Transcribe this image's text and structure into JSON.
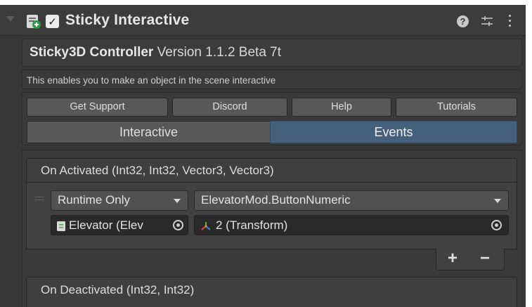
{
  "component": {
    "title": "Sticky Interactive",
    "enabled": true,
    "help_icon": "?",
    "icons": [
      "script-icon",
      "help-icon",
      "presets-icon",
      "kebab-menu-icon"
    ]
  },
  "controller": {
    "name": "Sticky3D Controller",
    "version": "Version 1.1.2 Beta 7t",
    "description": "This enables you to make an object in the scene interactive"
  },
  "buttons": {
    "get_support": "Get Support",
    "discord": "Discord",
    "help": "Help",
    "tutorials": "Tutorials"
  },
  "tabs": [
    {
      "label": "Interactive",
      "active": false
    },
    {
      "label": "Events",
      "active": true
    }
  ],
  "events": {
    "on_activated": {
      "title": "On Activated (Int32, Int32, Vector3, Vector3)",
      "listener": {
        "call_state": "Runtime Only",
        "function": "ElevatorMod.ButtonNumeric",
        "object": "Elevator (Elev",
        "argument": "2 (Transform)"
      }
    },
    "on_deactivated": {
      "title": "On Deactivated (Int32, Int32)"
    },
    "add_label": "+",
    "remove_label": "−"
  },
  "colors": {
    "background": "#383838",
    "active_tab": "#46607c",
    "button": "#585858"
  }
}
